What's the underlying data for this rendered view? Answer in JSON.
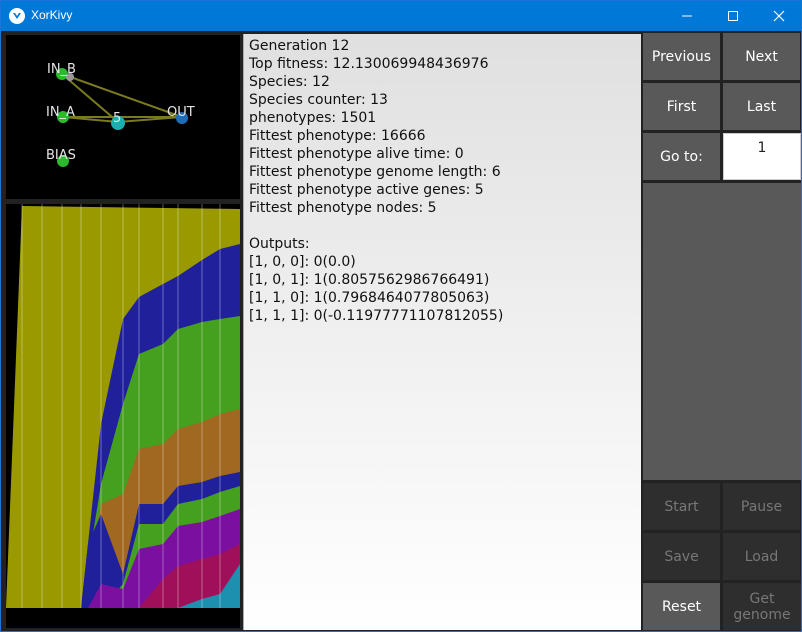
{
  "window": {
    "title": "XorKivy"
  },
  "network": {
    "nodes": [
      "IN_B",
      "IN_A",
      "5",
      "OUT",
      "BIAS"
    ]
  },
  "info": {
    "lines": [
      "Generation 12",
      "Top fitness: 12.130069948436976",
      "Species: 12",
      "Species counter: 13",
      "phenotypes: 1501",
      "Fittest phenotype: 16666",
      "Fittest phenotype alive time: 0",
      "Fittest phenotype genome length: 6",
      "Fittest phenotype active genes: 5",
      "Fittest phenotype nodes: 5",
      "",
      "Outputs:",
      "[1, 0, 0]: 0(0.0)",
      "[1, 0, 1]: 1(0.8057562986766491)",
      "[1, 1, 0]: 1(0.7968464077805063)",
      "[1, 1, 1]: 0(-0.11977771107812055)"
    ]
  },
  "controls": {
    "previous": "Previous",
    "next": "Next",
    "first": "First",
    "last": "Last",
    "goto": "Go to:",
    "goto_value": "1",
    "start": "Start",
    "pause": "Pause",
    "save": "Save",
    "load": "Load",
    "reset": "Reset",
    "get_genome": "Get genome"
  },
  "colors": {
    "title_bar": "#0078d7",
    "button": "#595959",
    "button_disabled": "#2e2e2e",
    "species_colors": [
      "#9a9a00",
      "#20209a",
      "#45a020",
      "#a06820",
      "#7a0fa0",
      "#a0105a",
      "#1d90b0"
    ]
  }
}
